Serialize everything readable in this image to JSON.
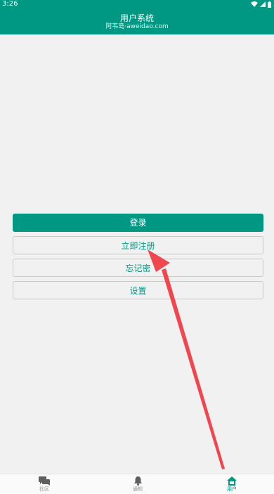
{
  "status_bar": {
    "time": "3:26"
  },
  "app_bar": {
    "title": "用户系统",
    "subtitle": "阿韦岛·aweidao.com"
  },
  "buttons": {
    "login": "登录",
    "register": "立即注册",
    "forgot_password": "忘记密",
    "settings": "设置"
  },
  "bottom_nav": [
    {
      "label": "社区",
      "icon": "chat-bubbles-icon"
    },
    {
      "label": "通知",
      "icon": "bell-icon"
    },
    {
      "label": "用户",
      "icon": "home-user-icon",
      "active": true
    }
  ],
  "colors": {
    "primary": "#009883",
    "arrow": "#f0474f",
    "background": "#f1f1f1"
  }
}
